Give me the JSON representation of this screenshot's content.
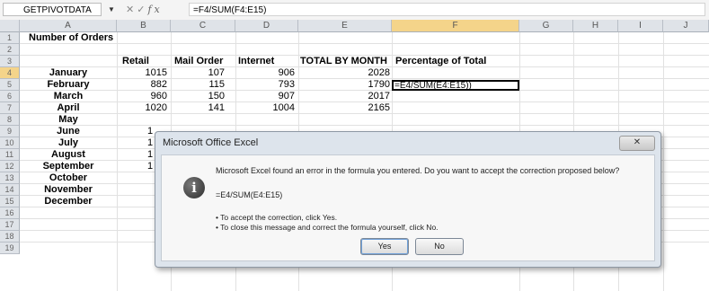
{
  "formula_bar": {
    "name_box": "GETPIVOTDATA",
    "fx_symbol": "fx",
    "formula": "=F4/SUM(F4:E15)"
  },
  "columns": [
    "A",
    "B",
    "C",
    "D",
    "E",
    "F",
    "G",
    "H",
    "I",
    "J"
  ],
  "rows": [
    "1",
    "2",
    "3",
    "4",
    "5",
    "6",
    "7",
    "8",
    "9",
    "10",
    "11",
    "12",
    "13",
    "14",
    "15",
    "16",
    "17",
    "18",
    "19"
  ],
  "sheet": {
    "a1": "Number of Orders",
    "headers": [
      "Retail",
      "Mail Order",
      "Internet",
      "TOTAL BY MONTH",
      "Percentage of Total"
    ],
    "months": [
      "January",
      "February",
      "March",
      "April",
      "May",
      "June",
      "July",
      "August",
      "September",
      "October",
      "November",
      "December"
    ],
    "data": [
      {
        "retail": "1015",
        "mail": "107",
        "internet": "906",
        "total": "2028"
      },
      {
        "retail": "882",
        "mail": "115",
        "internet": "793",
        "total": "1790"
      },
      {
        "retail": "960",
        "mail": "150",
        "internet": "907",
        "total": "2017"
      },
      {
        "retail": "1020",
        "mail": "141",
        "internet": "1004",
        "total": "2165"
      }
    ],
    "partial_retail": [
      "1",
      "1",
      "1",
      "1"
    ],
    "active_cell_text": "=E4/SUM(E4:E15))"
  },
  "dialog": {
    "title": "Microsoft Office Excel",
    "close_label": "✕",
    "message": "Microsoft Excel found an error in the formula you entered. Do you want to accept the correction proposed below?",
    "proposed": "=E4/SUM(E4:E15)",
    "bullet1": "• To accept the correction, click Yes.",
    "bullet2": "• To close this message and correct the formula yourself, click No.",
    "yes_label": "Yes",
    "no_label": "No"
  }
}
